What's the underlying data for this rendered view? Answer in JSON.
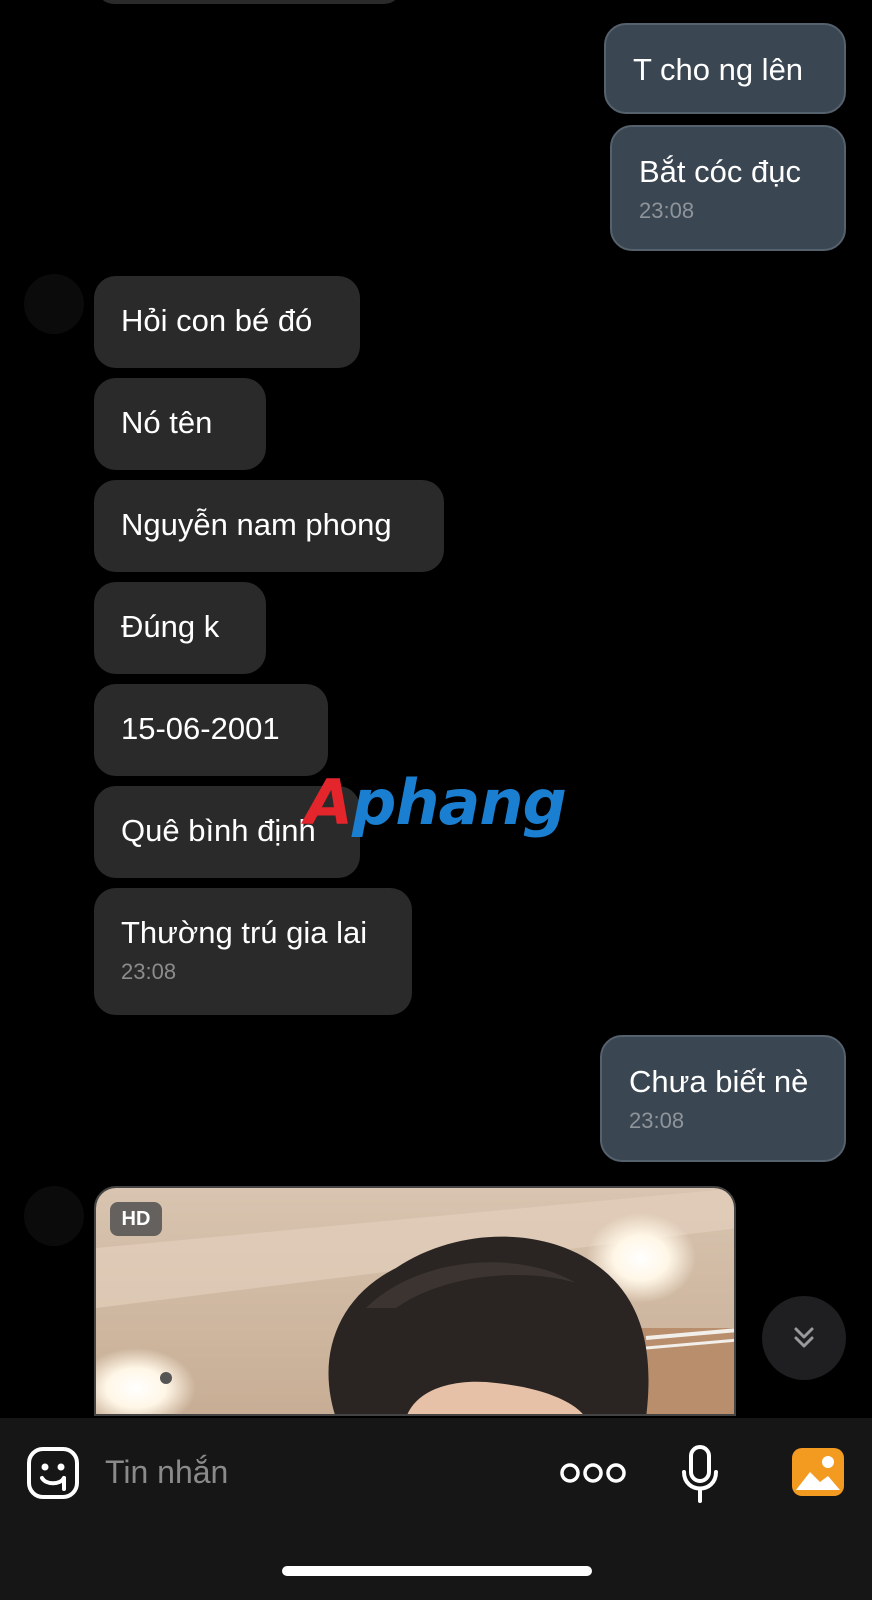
{
  "chat": {
    "messages": [
      {
        "direction": "outgoing",
        "text": "T cho ng lên"
      },
      {
        "direction": "outgoing",
        "text": "Bắt cóc đục",
        "time": "23:08"
      },
      {
        "direction": "incoming",
        "text": "Hỏi con bé đó"
      },
      {
        "direction": "incoming",
        "text": "Nó tên"
      },
      {
        "direction": "incoming",
        "text": "Nguyễn nam phong"
      },
      {
        "direction": "incoming",
        "text": "Đúng k"
      },
      {
        "direction": "incoming",
        "text": "15-06-2001"
      },
      {
        "direction": "incoming",
        "text": "Quê bình định"
      },
      {
        "direction": "incoming",
        "text": "Thường trú gia lai",
        "time": "23:08"
      },
      {
        "direction": "outgoing",
        "text": "Chưa biết nè",
        "time": "23:08"
      }
    ],
    "photo_badge": "HD"
  },
  "watermark": {
    "part1": "A",
    "part2": "phang"
  },
  "composer": {
    "placeholder": "Tin nhắn",
    "icons": [
      "sticker-icon",
      "more-icon",
      "microphone-icon",
      "gallery-icon",
      "scroll-down-icon"
    ]
  },
  "colors": {
    "background": "#000000",
    "outgoing_bubble": "#3a4652",
    "incoming_bubble": "#2a2a2b",
    "accent_gallery": "#f39a20"
  }
}
